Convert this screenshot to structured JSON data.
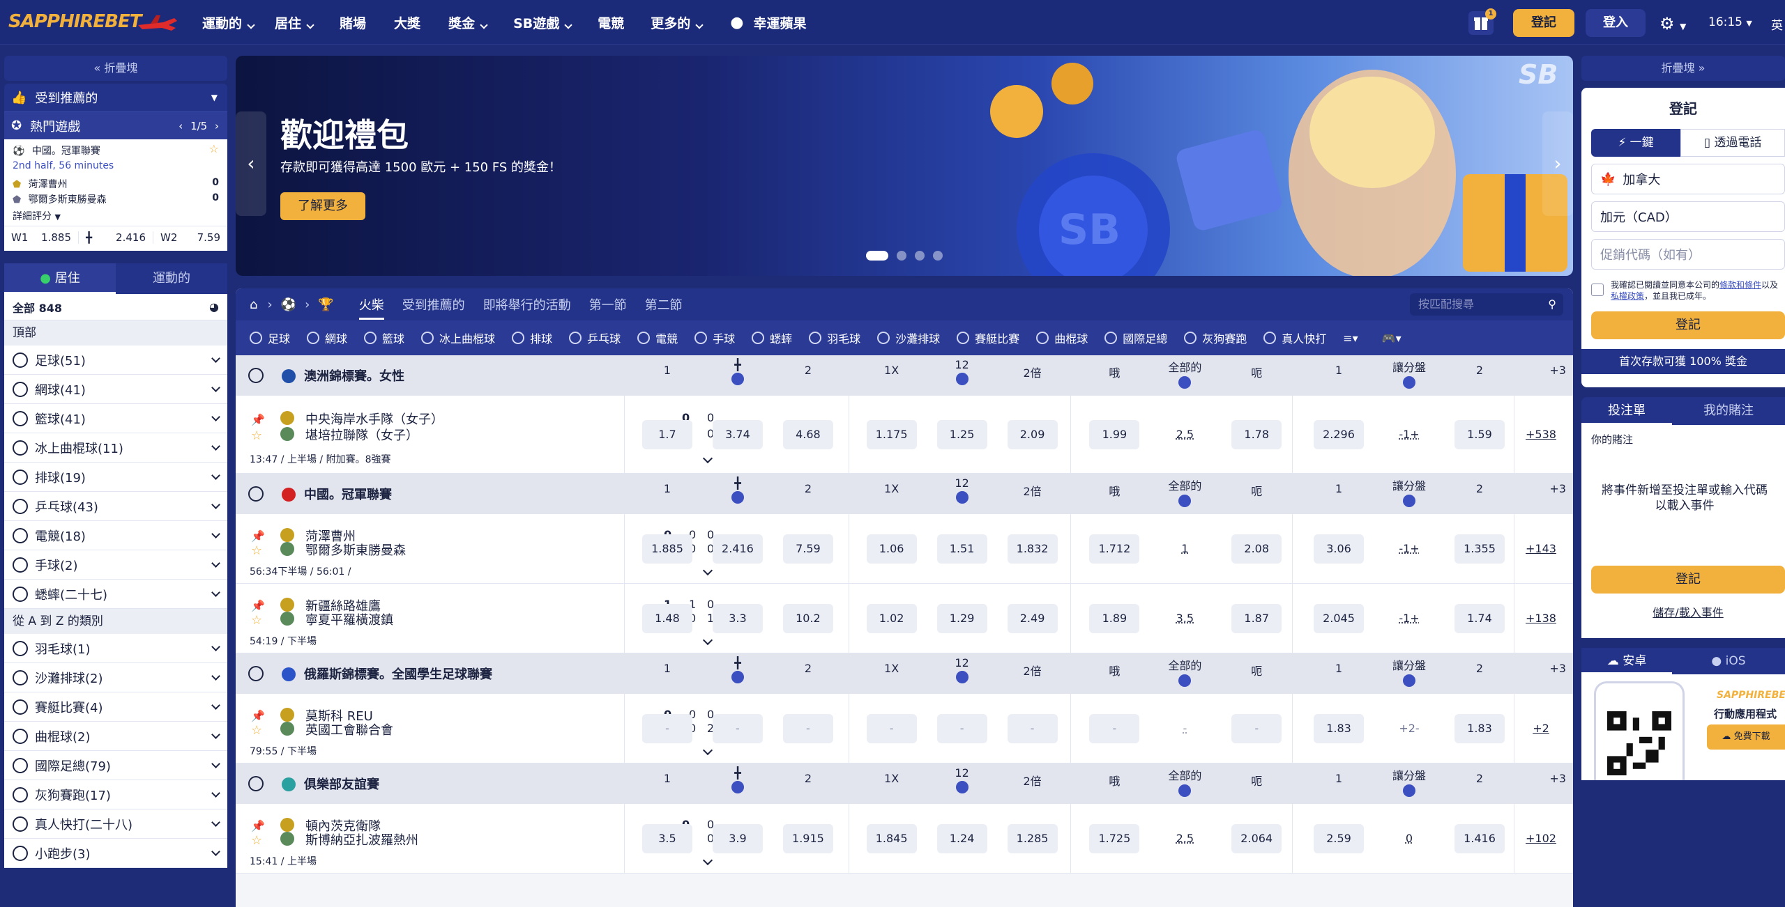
{
  "header": {
    "logo": "SAPPHIREBET",
    "nav": [
      {
        "label": "運動的",
        "chevron": true
      },
      {
        "label": "居住",
        "chevron": true
      },
      {
        "label": "賭場",
        "chevron": false
      },
      {
        "label": "大獎",
        "chevron": false
      },
      {
        "label": "獎金",
        "chevron": true
      },
      {
        "label": "SB遊戲",
        "chevron": true
      },
      {
        "label": "電競",
        "chevron": false
      },
      {
        "label": "更多的",
        "chevron": true
      },
      {
        "label": "幸運蘋果",
        "chevron": false
      }
    ],
    "gift_badge": "1",
    "register": "登記",
    "login": "登入",
    "time": "16:15",
    "language": "英"
  },
  "left": {
    "collapse": "折疊塊",
    "recommended": "受到推薦的",
    "hot_games": "熱門遊戲",
    "hot_pager": "1/5",
    "hot_match": {
      "league": "中國。冠軍聯賽",
      "status": "2nd half, 56 minutes",
      "team1": "菏澤曹州",
      "team2": "鄂爾多斯東勝曼森",
      "score1": "0",
      "score2": "0",
      "details": "詳細評分",
      "w1_label": "W1",
      "w1": "1.885",
      "x_label": "╋",
      "x": "2.416",
      "w2_label": "W2",
      "w2": "7.59"
    },
    "tab_live": "居住",
    "tab_sports": "運動的",
    "all_label": "全部 848",
    "top_section": "頂部",
    "top_sports": [
      "足球(51)",
      "網球(41)",
      "籃球(41)",
      "冰上曲棍球(11)",
      "排球(19)",
      "乒乓球(43)",
      "電競(18)",
      "手球(2)",
      "蟋蟀(二十七)"
    ],
    "az_section": "從 A 到 Z 的類別",
    "az_sports": [
      "羽毛球(1)",
      "沙灘排球(2)",
      "賽艇比賽(4)",
      "曲棍球(2)",
      "國際足總(79)",
      "灰狗賽跑(17)",
      "真人快打(二十八)",
      "小跑步(3)"
    ]
  },
  "banner": {
    "title": "歡迎禮包",
    "subtitle": "存款即可獲得高達 1500 歐元 + 150 FS 的獎金！",
    "button": "了解更多"
  },
  "main": {
    "tabs": [
      "火柴",
      "受到推薦的",
      "即將舉行的活動",
      "第一節",
      "第二節"
    ],
    "search_placeholder": "按匹配搜尋",
    "sports": [
      "足球",
      "網球",
      "籃球",
      "冰上曲棍球",
      "排球",
      "乒乓球",
      "電競",
      "手球",
      "蟋蟀",
      "羽毛球",
      "沙灘排球",
      "賽艇比賽",
      "曲棍球",
      "國際足總",
      "灰狗賽跑",
      "真人快打"
    ],
    "col_headers": [
      "1",
      "╋",
      "2",
      "1X",
      "12",
      "2倍",
      "哦",
      "全部的",
      "呃",
      "1",
      "讓分盤",
      "2",
      "+3"
    ],
    "leagues": [
      {
        "name": "澳洲錦標賽。女性",
        "flag": "#1f4fa8",
        "matches": [
          {
            "team1": "中央海岸水手隊（女子）",
            "team2": "堪培拉聯隊（女子）",
            "s1": [
              "0",
              "0"
            ],
            "s2": [
              "0",
              "0"
            ],
            "info": "13:47 / 上半場 / 附加賽。8強賽",
            "odds": [
              "1.7",
              "3.74",
              "4.68",
              "1.175",
              "1.25",
              "2.09",
              "1.99",
              "2.5",
              "1.78",
              "2.296",
              "-1+",
              "1.59"
            ],
            "more": "+538"
          }
        ]
      },
      {
        "name": "中國。冠軍聯賽",
        "flag": "#d32020",
        "matches": [
          {
            "team1": "菏澤曹州",
            "team2": "鄂爾多斯東勝曼森",
            "s1": [
              "0",
              "0",
              "0"
            ],
            "s2": [
              "0",
              "0",
              "0"
            ],
            "info": "56:34下半場 / 56:01 /",
            "odds": [
              "1.885",
              "2.416",
              "7.59",
              "1.06",
              "1.51",
              "1.832",
              "1.712",
              "1",
              "2.08",
              "3.06",
              "-1+",
              "1.355"
            ],
            "more": "+143"
          },
          {
            "team1": "新疆絲路雄鷹",
            "team2": "寧夏平羅橫渡鎮",
            "s1": [
              "1",
              "1",
              "0"
            ],
            "s2": [
              "1",
              "0",
              "1"
            ],
            "info": "54:19 / 下半場",
            "odds": [
              "1.48",
              "3.3",
              "10.2",
              "1.02",
              "1.29",
              "2.49",
              "1.89",
              "3.5",
              "1.87",
              "2.045",
              "-1+",
              "1.74"
            ],
            "more": "+138"
          }
        ]
      },
      {
        "name": "俄羅斯錦標賽。全國學生足球聯賽",
        "flag": "#2a54c8",
        "matches": [
          {
            "team1": "莫斯科 REU",
            "team2": "英國工會聯合會",
            "s1": [
              "0",
              "0",
              "0"
            ],
            "s2": [
              "2",
              "0",
              "2"
            ],
            "info": "79:55 / 下半場",
            "odds": [
              "-",
              "-",
              "-",
              "-",
              "-",
              "-",
              "-",
              "-",
              "-",
              "1.83",
              "+2-",
              "1.83"
            ],
            "more": "+2"
          }
        ]
      },
      {
        "name": "俱樂部友誼賽",
        "flag": "#2aa0a0",
        "matches": [
          {
            "team1": "頓內茨克衛隊",
            "team2": "斯博納亞扎波羅熱州",
            "s1": [
              "0",
              "0"
            ],
            "s2": [
              "0",
              "0"
            ],
            "info": "15:41 / 上半場",
            "odds": [
              "3.5",
              "3.9",
              "1.915",
              "1.845",
              "1.24",
              "1.285",
              "1.725",
              "2.5",
              "2.064",
              "2.59",
              "0",
              "1.416"
            ],
            "more": "+102"
          }
        ]
      }
    ]
  },
  "right": {
    "collapse": "折疊塊",
    "login_title": "登記",
    "tab_oneclick": "一鍵",
    "tab_phone": "透過電話",
    "country": "加拿大",
    "currency": "加元（CAD）",
    "promo_placeholder": "促銷代碼（如有）",
    "terms_a": "我確認已閱讀並同意本公司的",
    "terms_link1": "條款和條件",
    "terms_b": "以及",
    "terms_link2": "私權政策",
    "terms_c": "，並且我已成年。",
    "register": "登記",
    "bonus": "首次存款可獲 100% 獎金",
    "betslip_tab": "投注單",
    "mybets_tab": "我的賭注",
    "your_bet": "你的賭注",
    "empty_msg": "將事件新增至投注單或輸入代碼以載入事件",
    "register2": "登記",
    "save_load": "儲存/載入事件",
    "android": "安卓",
    "ios": "iOS",
    "app_logo": "SAPPHIREBET",
    "app_title": "行動應用程式",
    "free_download": "免費下載"
  }
}
